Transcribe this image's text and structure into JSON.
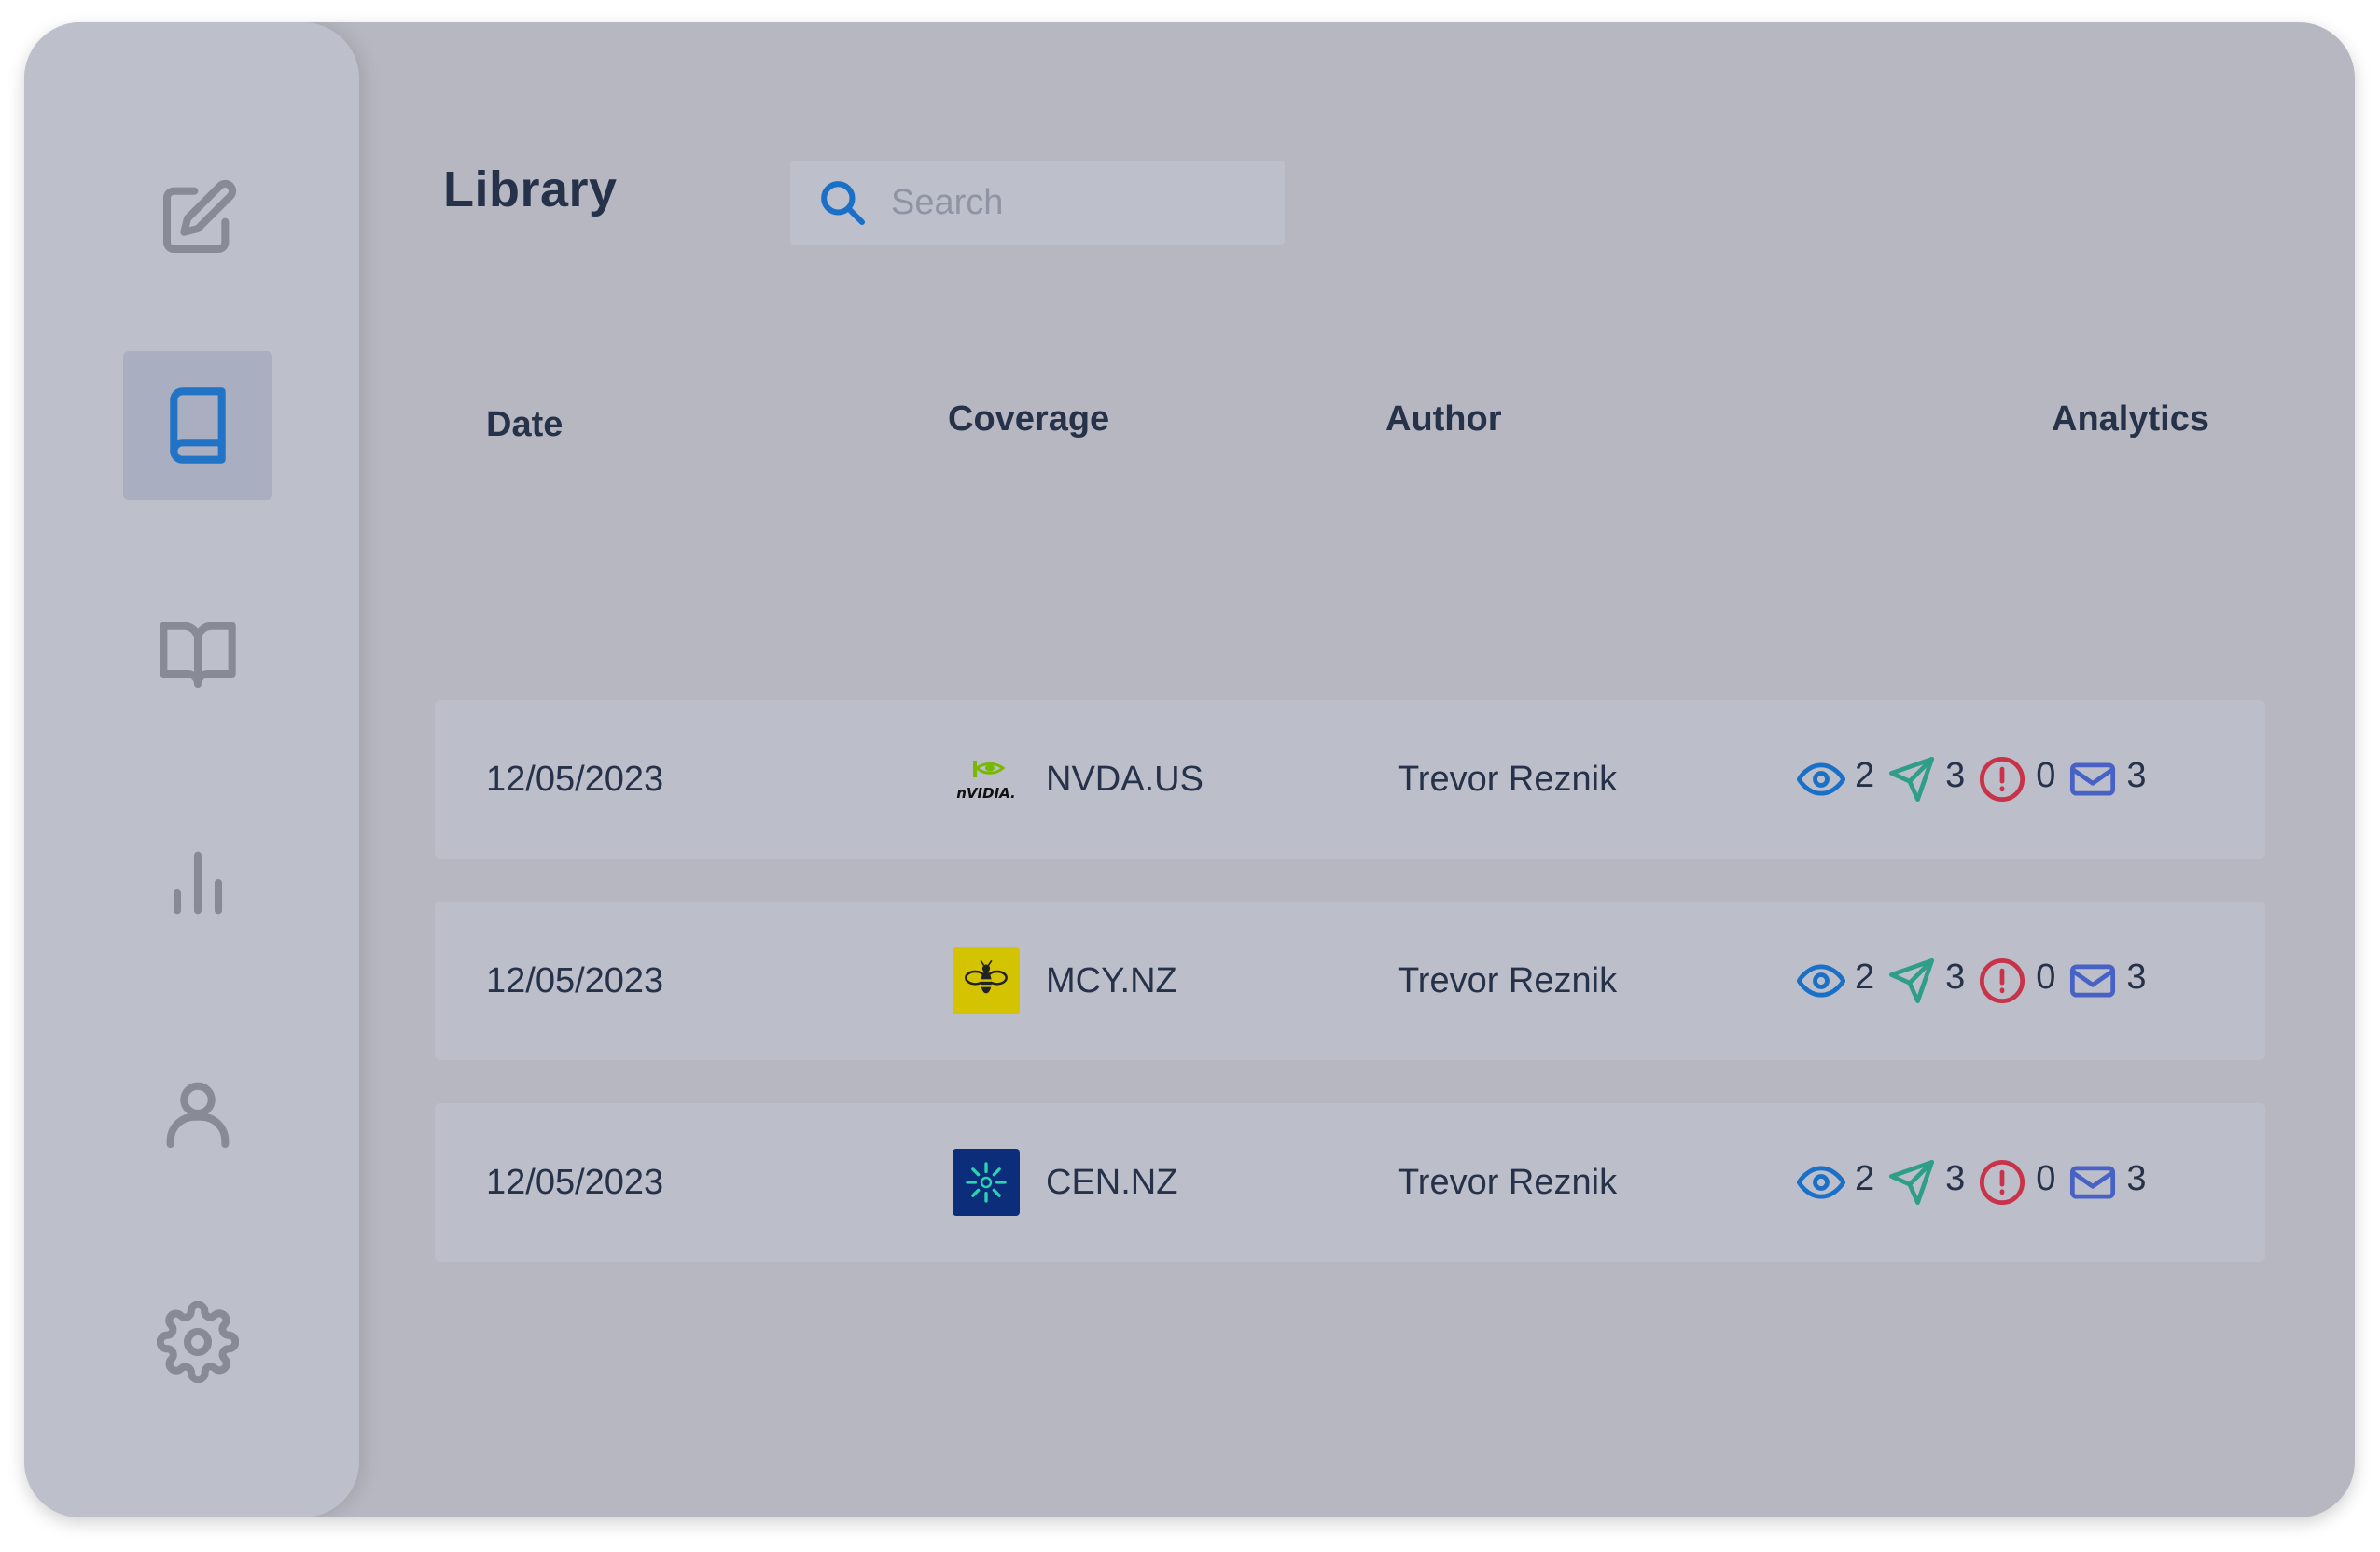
{
  "sidebar": {
    "items": [
      {
        "name": "compose",
        "icon": "edit-icon",
        "active": false
      },
      {
        "name": "library",
        "icon": "book-icon",
        "active": true
      },
      {
        "name": "reader",
        "icon": "open-book-icon",
        "active": false
      },
      {
        "name": "analytics",
        "icon": "bar-chart-icon",
        "active": false
      },
      {
        "name": "profile",
        "icon": "user-icon",
        "active": false
      },
      {
        "name": "settings",
        "icon": "gear-icon",
        "active": false
      }
    ]
  },
  "header": {
    "title": "Library",
    "search_placeholder": "Search",
    "search_icon": "search-icon"
  },
  "table": {
    "columns": {
      "date": "Date",
      "coverage": "Coverage",
      "author": "Author",
      "analytics": "Analytics"
    },
    "rows": [
      {
        "date": "12/05/2023",
        "logo": "nvidia-logo",
        "ticker": "NVDA.US",
        "author": "Trevor Reznik",
        "views": "2",
        "sent": "3",
        "alerts": "0",
        "messages": "3"
      },
      {
        "date": "12/05/2023",
        "logo": "bee-logo",
        "ticker": "MCY.NZ",
        "author": "Trevor Reznik",
        "views": "2",
        "sent": "3",
        "alerts": "0",
        "messages": "3"
      },
      {
        "date": "12/05/2023",
        "logo": "contact-logo",
        "ticker": "CEN.NZ",
        "author": "Trevor Reznik",
        "views": "2",
        "sent": "3",
        "alerts": "0",
        "messages": "3"
      }
    ]
  },
  "colors": {
    "accent": "#2173c6",
    "views": "#1a6fc7",
    "sent": "#2f9e88",
    "alerts": "#c8334a",
    "messages": "#4761c4",
    "nvidia_green": "#76b900",
    "bee_yellow": "#d4c300",
    "contact_navy": "#0b2d7a"
  }
}
